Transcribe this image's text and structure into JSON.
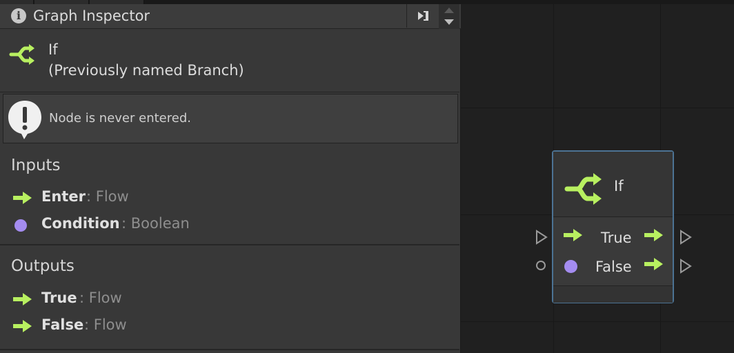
{
  "header": {
    "title": "Graph Inspector"
  },
  "node": {
    "title": "If",
    "subtitle": "(Previously named Branch)"
  },
  "warning": {
    "text": "Node is never entered."
  },
  "inputs": {
    "title": "Inputs",
    "ports": [
      {
        "name": "Enter",
        "type": ": Flow",
        "icon": "flow-arrow-icon"
      },
      {
        "name": "Condition",
        "type": ": Boolean",
        "icon": "boolean-dot-icon"
      }
    ]
  },
  "outputs": {
    "title": "Outputs",
    "ports": [
      {
        "name": "True",
        "type": ": Flow",
        "icon": "flow-arrow-icon"
      },
      {
        "name": "False",
        "type": ": Flow",
        "icon": "flow-arrow-icon"
      }
    ]
  },
  "graph_node": {
    "title": "If",
    "outputs": [
      {
        "label": "True"
      },
      {
        "label": "False"
      }
    ]
  },
  "colors": {
    "flow_green": "#b8f060",
    "boolean_purple": "#a48cf0",
    "node_border": "#4c7394",
    "panel_bg": "#383838",
    "canvas_bg": "#202020"
  }
}
